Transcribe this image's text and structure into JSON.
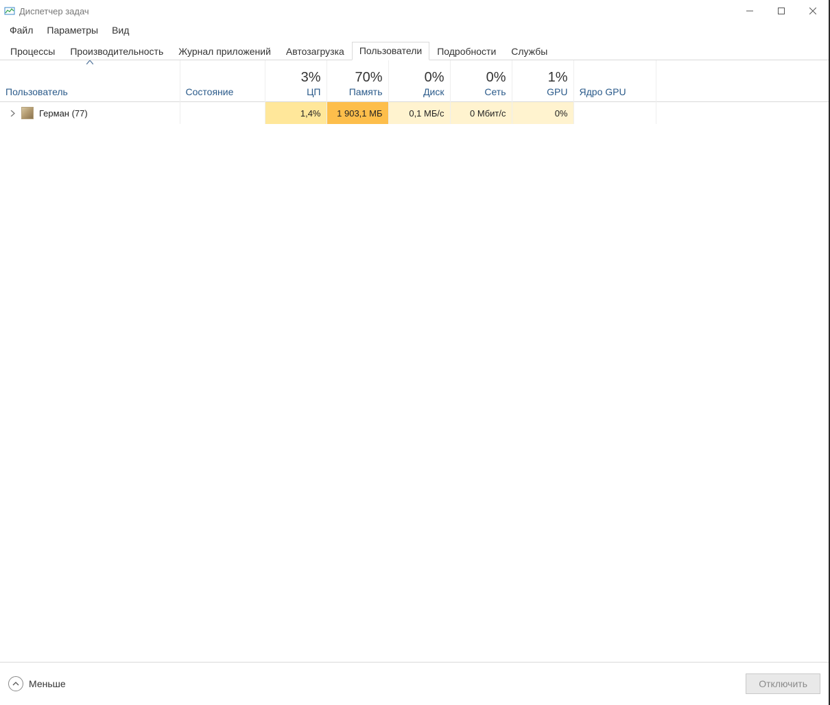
{
  "window": {
    "title": "Диспетчер задач"
  },
  "menu": {
    "file": "Файл",
    "options": "Параметры",
    "view": "Вид"
  },
  "tabs": {
    "processes": "Процессы",
    "performance": "Производительность",
    "apphistory": "Журнал приложений",
    "startup": "Автозагрузка",
    "users": "Пользователи",
    "details": "Подробности",
    "services": "Службы"
  },
  "columns": {
    "user": "Пользователь",
    "state": "Состояние",
    "cpu": {
      "value": "3%",
      "label": "ЦП"
    },
    "mem": {
      "value": "70%",
      "label": "Память"
    },
    "disk": {
      "value": "0%",
      "label": "Диск"
    },
    "net": {
      "value": "0%",
      "label": "Сеть"
    },
    "gpu": {
      "value": "1%",
      "label": "GPU"
    },
    "gpucore": "Ядро GPU"
  },
  "rows": [
    {
      "name": "Герман (77)",
      "state": "",
      "cpu": "1,4%",
      "mem": "1 903,1 МБ",
      "disk": "0,1 МБ/с",
      "net": "0 Мбит/с",
      "gpu": "0%",
      "gpucore": ""
    }
  ],
  "footer": {
    "fewer": "Меньше",
    "disconnect": "Отключить"
  }
}
